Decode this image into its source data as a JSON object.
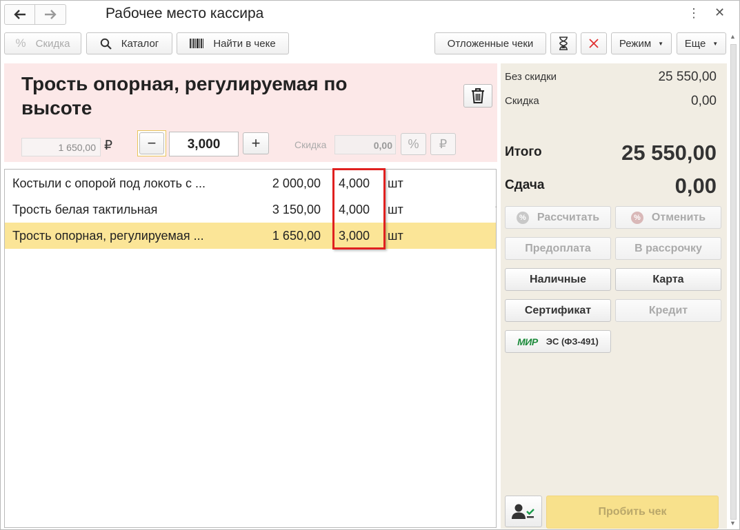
{
  "window": {
    "title": "Рабочее место кассира",
    "back_icon": "arrow-left-icon",
    "forward_icon": "arrow-right-icon",
    "more_glyph": "⋮",
    "close_glyph": "✕"
  },
  "toolbar": {
    "discount_label": "Скидка",
    "catalog_label": "Каталог",
    "find_label": "Найти в чеке",
    "deferred_label": "Отложенные чеки",
    "mode_label": "Режим",
    "more_label": "Еще"
  },
  "product": {
    "title": "Трость опорная, регулируемая по высоте",
    "price": "1 650,00",
    "currency": "₽",
    "quantity": "3,000",
    "discount_label": "Скидка",
    "discount_value": "0,00",
    "minus": "−",
    "plus": "+"
  },
  "table": {
    "rows": [
      {
        "name": "Костыли с опорой под локоть с ...",
        "price": "2 000,00",
        "qty": "4,000",
        "unit": "шт"
      },
      {
        "name": "Трость белая тактильная",
        "price": "3 150,00",
        "qty": "4,000",
        "unit": "шт"
      },
      {
        "name": "Трость опорная, регулируемая ...",
        "price": "1 650,00",
        "qty": "3,000",
        "unit": "шт"
      }
    ],
    "selected_index": 2
  },
  "summary": {
    "no_discount_label": "Без скидки",
    "no_discount_value": "25 550,00",
    "discount_label": "Скидка",
    "discount_value": "0,00",
    "total_label": "Итого",
    "total_value": "25 550,00",
    "change_label": "Сдача",
    "change_value": "0,00"
  },
  "payment": {
    "calculate": "Рассчитать",
    "cancel": "Отменить",
    "prepayment": "Предоплата",
    "installment": "В рассрочку",
    "cash": "Наличные",
    "card": "Карта",
    "certificate": "Сертификат",
    "credit": "Кредит",
    "mir_logo": "МИР",
    "es": "ЭС (ФЗ-491)",
    "print": "Пробить чек"
  },
  "colors": {
    "product_panel": "#fce8e8",
    "selected_row": "#fbe597",
    "right_panel": "#f1ede3",
    "highlight": "#e0201f",
    "print_button": "#f8e18c"
  }
}
